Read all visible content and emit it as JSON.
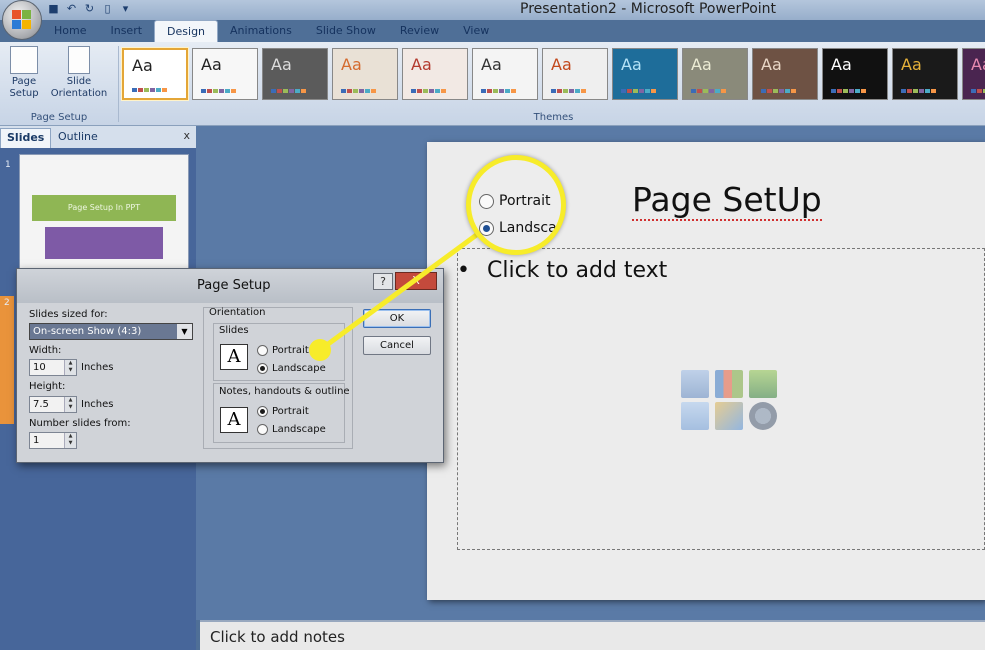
{
  "window": {
    "title": "Presentation2 - Microsoft PowerPoint"
  },
  "qat": {
    "save_icon": "save-icon",
    "undo_icon": "undo-icon",
    "redo_icon": "redo-icon",
    "new_icon": "new-document-icon"
  },
  "tabs": [
    {
      "label": "Home"
    },
    {
      "label": "Insert"
    },
    {
      "label": "Design"
    },
    {
      "label": "Animations"
    },
    {
      "label": "Slide Show"
    },
    {
      "label": "Review"
    },
    {
      "label": "View"
    }
  ],
  "ribbon": {
    "page_setup_label": "Page Setup",
    "page_setup_group": "Page Setup",
    "slide_orientation_label": "Slide Orientation",
    "themes_group": "Themes",
    "themes": [
      {
        "bg": "#ffffff",
        "fg": "#222222"
      },
      {
        "bg": "#f7f7f7",
        "fg": "#222222"
      },
      {
        "bg": "#5b5b5b",
        "fg": "#dddddd"
      },
      {
        "bg": "#e9e1d6",
        "fg": "#d46a2e"
      },
      {
        "bg": "#f2e9e4",
        "fg": "#b33a2e"
      },
      {
        "bg": "#f4f4f4",
        "fg": "#333333"
      },
      {
        "bg": "#efefef",
        "fg": "#c2481c"
      },
      {
        "bg": "#1e6d9a",
        "fg": "#b5e3f7"
      },
      {
        "bg": "#8a8a7a",
        "fg": "#ededd5"
      },
      {
        "bg": "#6e5244",
        "fg": "#e9d7c7"
      },
      {
        "bg": "#111111",
        "fg": "#ffffff"
      },
      {
        "bg": "#1a1a1a",
        "fg": "#e7b23a"
      },
      {
        "bg": "#4a2550",
        "fg": "#e78ab0"
      }
    ],
    "theme_text": "Aa"
  },
  "left_pane": {
    "tab_slides": "Slides",
    "tab_outline": "Outline",
    "close": "x",
    "slide1_number": "1",
    "slide2_number": "2",
    "thumb_title": "Page Setup In PPT"
  },
  "slide": {
    "title": "Page SetUp",
    "bullet": "•",
    "body": "Click to add text"
  },
  "notes": {
    "text": "Click to add notes"
  },
  "dialog": {
    "title": "Page Setup",
    "help": "?",
    "close": "X",
    "slides_sized_for": "Slides sized for:",
    "size_value": "On-screen Show (4:3)",
    "width_label": "Width:",
    "width_value": "10",
    "width_unit": "Inches",
    "height_label": "Height:",
    "height_value": "7.5",
    "height_unit": "Inches",
    "number_from_label": "Number slides from:",
    "number_from_value": "1",
    "orientation_label": "Orientation",
    "slides_label": "Slides",
    "notes_label": "Notes, handouts & outline",
    "portrait": "Portrait",
    "landscape": "Landscape",
    "ok": "OK",
    "cancel": "Cancel",
    "a_glyph": "A"
  },
  "magnifier": {
    "portrait": "Portrait",
    "landscape": "Landscape"
  },
  "colors": {
    "highlight": "#f7ec2a",
    "accent": "#e4a637"
  }
}
